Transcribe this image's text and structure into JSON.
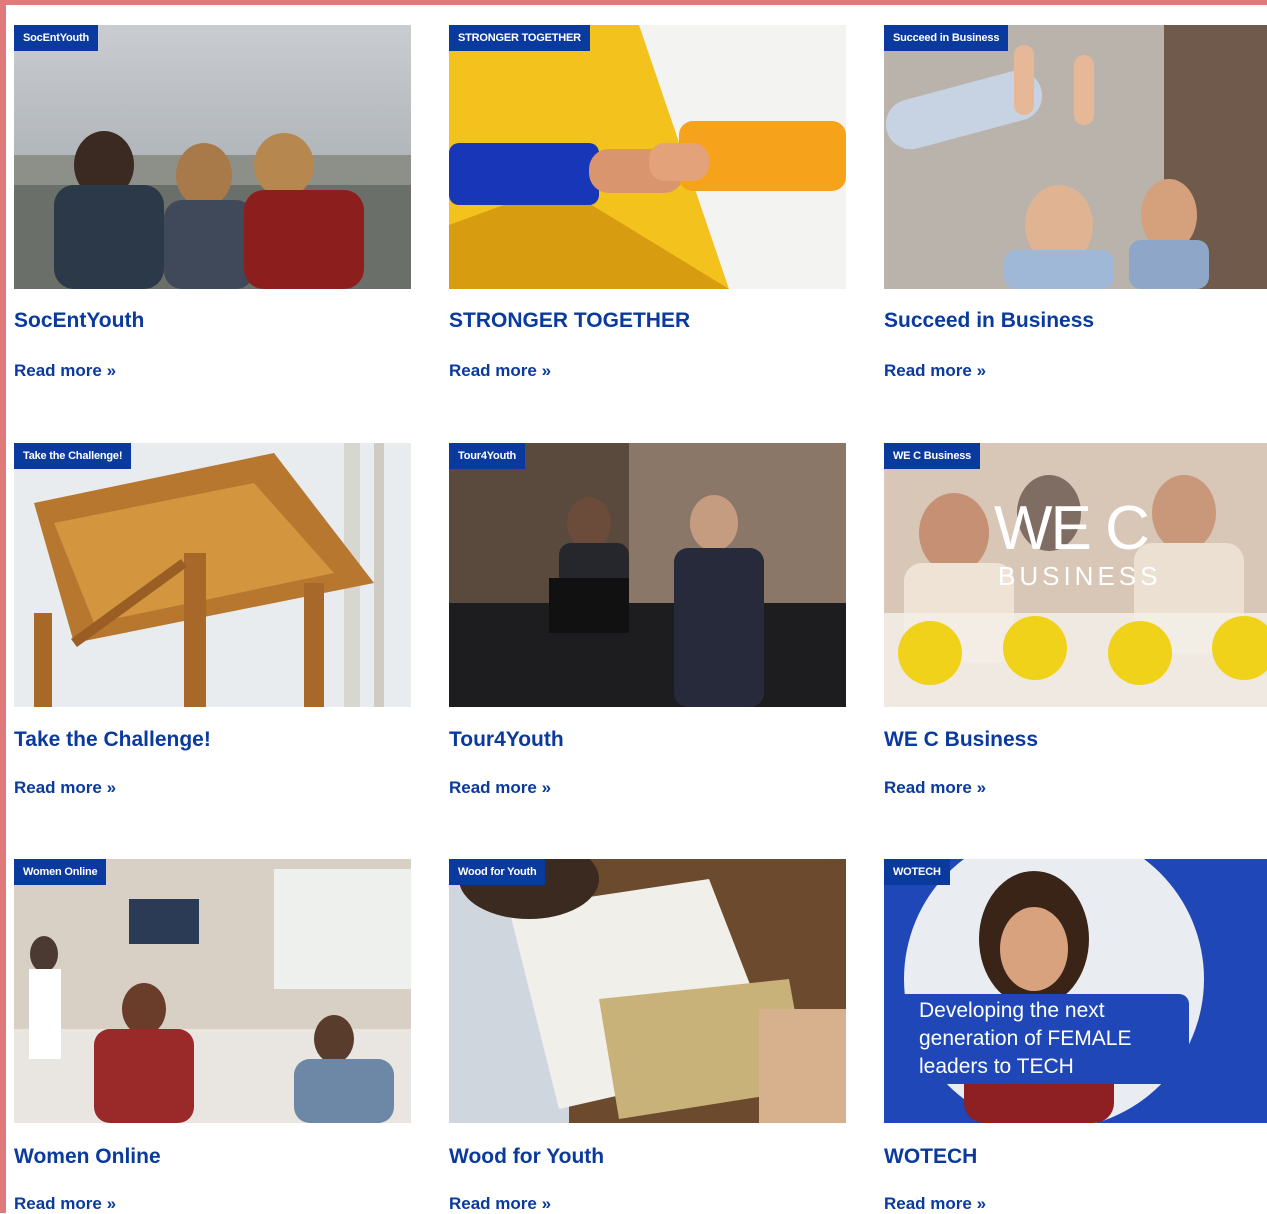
{
  "projects": [
    {
      "tag": "SocEntYouth",
      "title": "SocEntYouth",
      "link": "Read more »",
      "image": "people-overlooking-city"
    },
    {
      "tag": "STRONGER TOGETHER",
      "title": "STRONGER TOGETHER",
      "link": "Read more »",
      "image": "handshake-blue-yellow"
    },
    {
      "tag": "Succeed in Business",
      "title": "Succeed in Business",
      "link": "Read more »",
      "image": "women-high-five"
    },
    {
      "tag": "Take the Challenge!",
      "title": "Take the Challenge!",
      "link": "Read more »",
      "image": "wooden-pergola"
    },
    {
      "tag": "Tour4Youth",
      "title": "Tour4Youth",
      "link": "Read more »",
      "image": "hotel-reception"
    },
    {
      "tag": "WE C Business",
      "title": "WE C Business",
      "link": "Read more »",
      "image": "women-business-logo",
      "overlay_line1": "WE C",
      "overlay_line2": "BUSINESS"
    },
    {
      "tag": "Women Online",
      "title": "Women Online",
      "link": "Read more »",
      "image": "workshop-room"
    },
    {
      "tag": "Wood for Youth",
      "title": "Wood for Youth",
      "link": "Read more »",
      "image": "person-reading-book"
    },
    {
      "tag": "WOTECH",
      "title": "WOTECH",
      "link": "Read more »",
      "image": "smiling-woman-tech",
      "overlay_text": "Developing the next generation of FEMALE leaders to TECH"
    }
  ],
  "colors": {
    "brand_blue": "#0b3a9e",
    "frame": "#e07a7a"
  }
}
